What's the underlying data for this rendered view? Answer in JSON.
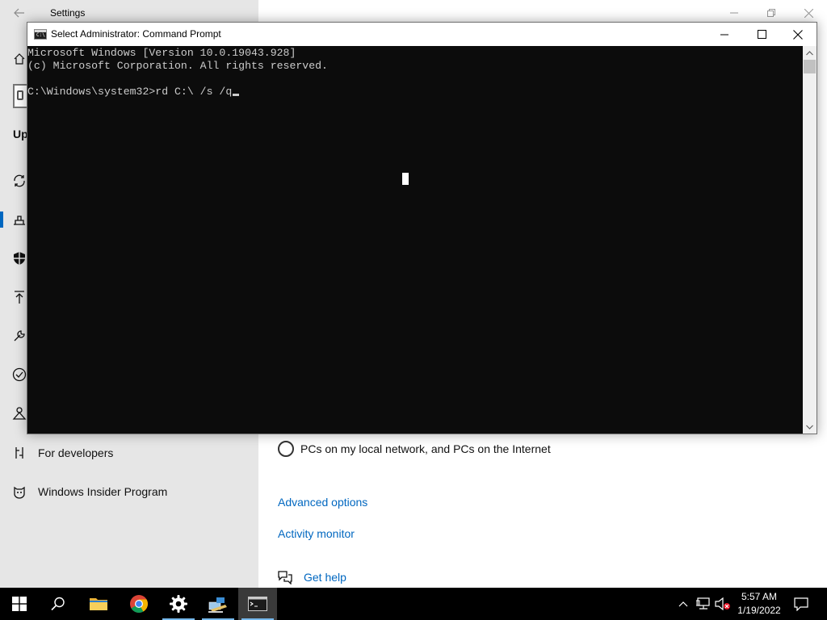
{
  "settings": {
    "title": "Settings",
    "section_truncated": "Up",
    "sidebar": {
      "items": [
        {
          "icon": "home-icon"
        },
        {
          "icon": "sync-icon"
        },
        {
          "icon": "delivery-optimization-icon"
        },
        {
          "icon": "shield-icon"
        },
        {
          "icon": "backup-icon"
        },
        {
          "icon": "troubleshoot-icon"
        },
        {
          "icon": "activation-icon"
        },
        {
          "icon": "find-device-icon"
        },
        {
          "icon": "developers-icon",
          "label": "For developers"
        },
        {
          "icon": "insider-cat-icon",
          "label": "Windows Insider Program"
        }
      ]
    },
    "main": {
      "radio_option": "PCs on my local network, and PCs on the Internet",
      "links": [
        "Advanced options",
        "Activity monitor"
      ],
      "help": "Get help"
    }
  },
  "cmd": {
    "title": "Select Administrator: Command Prompt",
    "icon_text": "C:\\",
    "lines": [
      "Microsoft Windows [Version 10.0.19043.928]",
      "(c) Microsoft Corporation. All rights reserved.",
      "",
      "C:\\Windows\\system32>rd C:\\ /s /q"
    ],
    "colors": {
      "background": "#0c0c0c",
      "text": "#cccccc"
    }
  },
  "taskbar": {
    "apps": [
      {
        "name": "start-button",
        "icon": "windows-logo-icon"
      },
      {
        "name": "search-button",
        "icon": "search-icon"
      },
      {
        "name": "file-explorer-button",
        "icon": "folder-icon"
      },
      {
        "name": "chrome-button",
        "icon": "chrome-icon"
      },
      {
        "name": "settings-button",
        "icon": "gear-icon"
      },
      {
        "name": "network-app-button",
        "icon": "network-app-icon"
      },
      {
        "name": "cmd-button",
        "icon": "cmd-icon"
      }
    ],
    "clock": {
      "time": "5:57 AM",
      "date": "1/19/2022"
    },
    "accent": "#76b9ed"
  }
}
